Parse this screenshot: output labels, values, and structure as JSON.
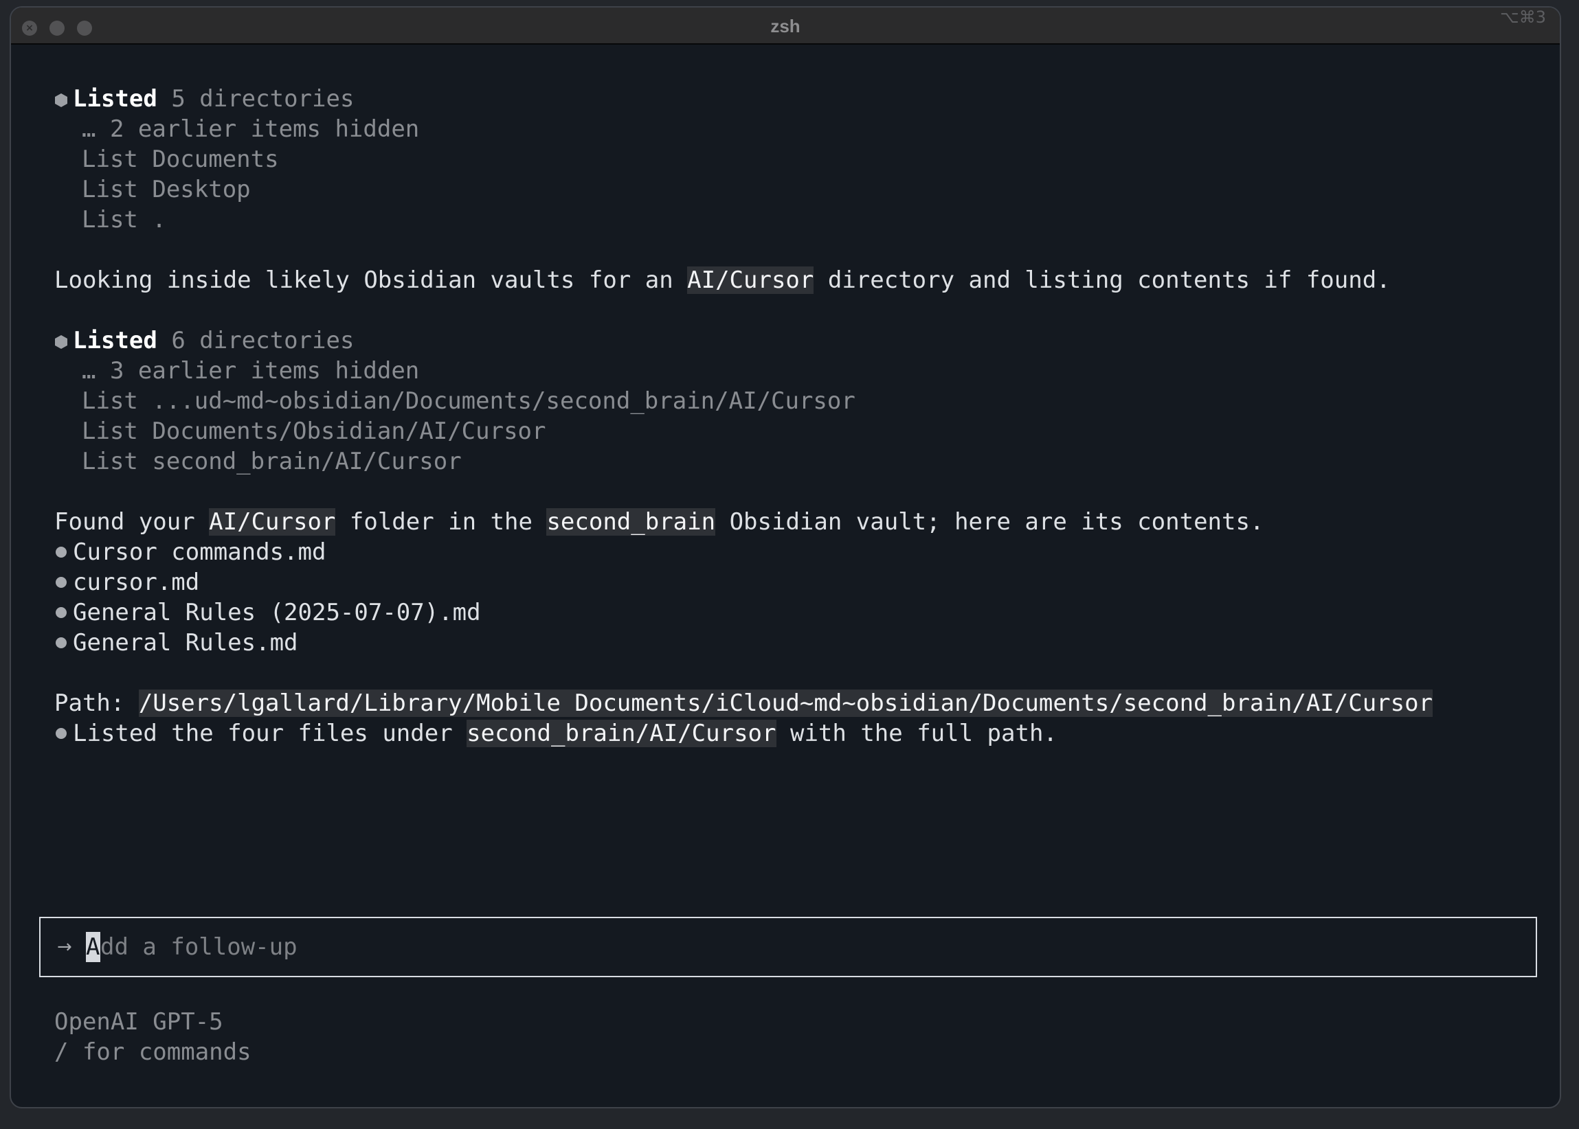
{
  "window": {
    "title": "zsh",
    "shortcut": "⌥⌘3"
  },
  "block1": {
    "heading_bold": "Listed",
    "heading_rest": "5 directories",
    "hidden": "… 2 earlier items hidden",
    "items": [
      "List Documents",
      "List Desktop",
      "List ."
    ]
  },
  "message1": {
    "before": "Looking inside likely Obsidian vaults for an ",
    "code": "AI/Cursor",
    "after": " directory and listing contents if found."
  },
  "block2": {
    "heading_bold": "Listed",
    "heading_rest": "6 directories",
    "hidden": "… 3 earlier items hidden",
    "items": [
      "List ...ud~md~obsidian/Documents/second_brain/AI/Cursor",
      "List Documents/Obsidian/AI/Cursor",
      "List second_brain/AI/Cursor"
    ]
  },
  "message2": {
    "p1": "Found your ",
    "c1": "AI/Cursor",
    "p2": " folder in the ",
    "c2": "second_brain",
    "p3": " Obsidian vault; here are its contents."
  },
  "files": [
    "Cursor commands.md",
    "cursor.md",
    "General Rules (2025-07-07).md",
    "General Rules.md"
  ],
  "path": {
    "label": "Path: ",
    "value": "/Users/lgallard/Library/Mobile Documents/iCloud~md~obsidian/Documents/second_brain/AI/Cursor"
  },
  "summary": {
    "before": "Listed the four files under ",
    "code": "second_brain/AI/Cursor",
    "after": " with the full path."
  },
  "input": {
    "arrow": "→",
    "cursor_char": "A",
    "placeholder": "dd a follow-up"
  },
  "footer": {
    "model": "OpenAI GPT-5",
    "hint": "/ for commands"
  }
}
